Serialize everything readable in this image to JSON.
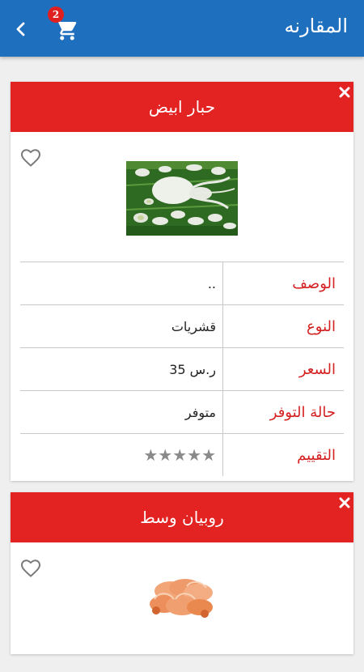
{
  "app_bar": {
    "title": "المقارنه",
    "cart_count": "2"
  },
  "products": [
    {
      "name": "حبار ابيض",
      "specs": [
        {
          "label": "الوصف",
          "value": ".."
        },
        {
          "label": "النوع",
          "value": "قشريات"
        },
        {
          "label": "السعر",
          "value": "ر.س 35"
        },
        {
          "label": "حالة التوفر",
          "value": "متوفر"
        },
        {
          "label": "التقييم",
          "value": "★★★★★"
        }
      ],
      "rating": 5
    },
    {
      "name": "روبيان وسط"
    }
  ],
  "colors": {
    "app_bar": "#1f6fbf",
    "card_header": "#e32222",
    "label_text": "#d42020",
    "badge": "#e02020"
  },
  "icons": [
    "back-chevron-icon",
    "cart-icon",
    "close-icon",
    "heart-icon"
  ]
}
